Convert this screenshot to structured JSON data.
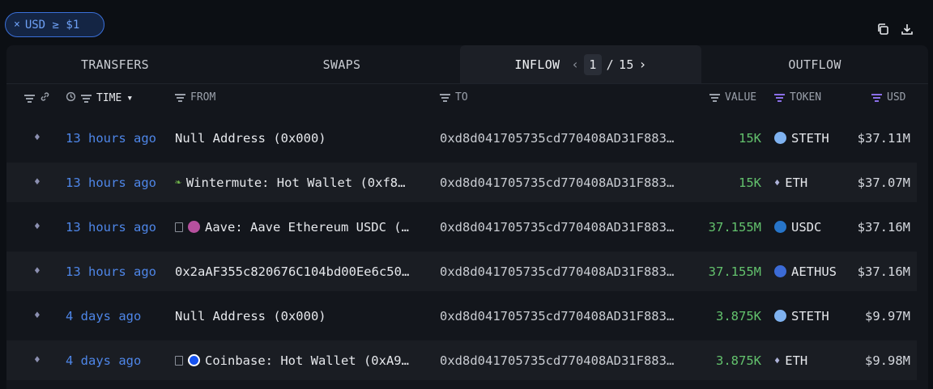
{
  "filter_chip": {
    "close": "×",
    "label": "USD ≥ $1"
  },
  "tabs": [
    "TRANSFERS",
    "SWAPS",
    "INFLOW",
    "OUTFLOW"
  ],
  "pager": {
    "prev": "‹",
    "current": "1",
    "separator": "/",
    "total": "15",
    "next": "›"
  },
  "columns": {
    "time": "TIME",
    "from": "FROM",
    "to": "TO",
    "value": "VALUE",
    "token": "TOKEN",
    "usd": "USD"
  },
  "sort_caret": "▾",
  "rows": [
    {
      "time": "13 hours ago",
      "from": "Null Address (0x000)",
      "to": "0xd8d041705735cd770408AD31F883…",
      "value": "15K",
      "token": "STETH",
      "usd": "$37.11M"
    },
    {
      "time": "13 hours ago",
      "from": "Wintermute: Hot Wallet (0xf8…",
      "to": "0xd8d041705735cd770408AD31F883…",
      "value": "15K",
      "token": "ETH",
      "usd": "$37.07M"
    },
    {
      "time": "13 hours ago",
      "from": "Aave: Aave Ethereum USDC (…",
      "to": "0xd8d041705735cd770408AD31F883…",
      "value": "37.155M",
      "token": "USDC",
      "usd": "$37.16M"
    },
    {
      "time": "13 hours ago",
      "from": "0x2aAF355c820676C104bd00Ee6c50…",
      "to": "0xd8d041705735cd770408AD31F883…",
      "value": "37.155M",
      "token": "AETHUS",
      "usd": "$37.16M"
    },
    {
      "time": "4 days ago",
      "from": "Null Address (0x000)",
      "to": "0xd8d041705735cd770408AD31F883…",
      "value": "3.875K",
      "token": "STETH",
      "usd": "$9.97M"
    },
    {
      "time": "4 days ago",
      "from": "Coinbase: Hot Wallet (0xA9…",
      "to": "0xd8d041705735cd770408AD31F883…",
      "value": "3.875K",
      "token": "ETH",
      "usd": "$9.98M"
    }
  ],
  "chain_glyph": "♦",
  "eth_glyph": "♦",
  "wintermute_glyph": "❧",
  "colors": {
    "accent": "#4e86e8",
    "value_green": "#63c26d",
    "filter_purple": "#8a6ee6"
  }
}
